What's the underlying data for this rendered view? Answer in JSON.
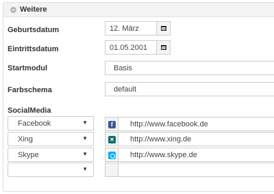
{
  "panel": {
    "title": "Weitere"
  },
  "fields": {
    "birthdate": {
      "label": "Geburtsdatum",
      "value": "12. März"
    },
    "entrydate": {
      "label": "Eintrittsdatum",
      "value": "01.05.2001"
    },
    "startmodule": {
      "label": "Startmodul",
      "value": "Basis"
    },
    "colorscheme": {
      "label": "Farbschema",
      "value": "default"
    }
  },
  "social": {
    "label": "SocialMedia",
    "rows": [
      {
        "network": "Facebook",
        "url": "http://www.facebook.de",
        "icon": "facebook-icon"
      },
      {
        "network": "Xing",
        "url": "http://www.xing.de",
        "icon": "xing-icon"
      },
      {
        "network": "Skype",
        "url": "http://www.skype.de",
        "icon": "skype-icon"
      },
      {
        "network": "",
        "url": "",
        "icon": ""
      }
    ]
  },
  "icons": {
    "calendar": "calendar-icon",
    "dropdown": "chevron-down-icon",
    "collapse": "collapse-icon"
  },
  "colors": {
    "facebook": "#3b5998",
    "xing": "#0f6d6b",
    "skype": "#00aff0",
    "header_bg": "#f3f3f3",
    "border": "#cccccc"
  },
  "glyphs": {
    "facebook": "f",
    "xing": "✕",
    "arrow": "▼"
  }
}
